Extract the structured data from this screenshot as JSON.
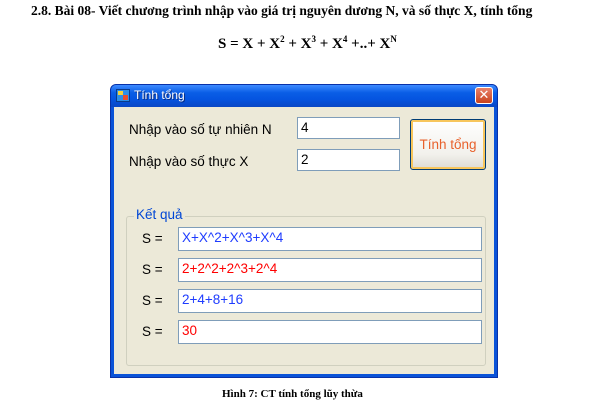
{
  "document": {
    "heading": "2.8. Bài 08- Viết chương trình nhập vào giá trị nguyên dương N, và số thực X, tính tổng",
    "formula": {
      "lhs": "S = X + X",
      "exp2": "2",
      "t3": " + X",
      "exp3": "3",
      "t4": " + X",
      "exp4": "4",
      "tail": " +..+ X",
      "expN": "N"
    },
    "caption": "Hình  7: CT tính tổng lũy thừa"
  },
  "window": {
    "title": "Tính tổng",
    "close_glyph": "✕",
    "title_color": "#0554e0"
  },
  "form": {
    "label_n": "Nhập vào số tự nhiên N",
    "value_n": "4",
    "label_x": "Nhập vào số thực X",
    "value_x": "2",
    "calc_button": "Tính tổng",
    "calc_button_color": "#e8612c"
  },
  "results": {
    "group_label": "Kết quả",
    "rows": [
      {
        "label": "S =",
        "value": "X+X^2+X^3+X^4",
        "color": "#1e3cff"
      },
      {
        "label": "S =",
        "value": "2+2^2+2^3+2^4",
        "color": "#ff0000"
      },
      {
        "label": "S =",
        "value": "2+4+8+16",
        "color": "#1e3cff"
      },
      {
        "label": "S =",
        "value": "30",
        "color": "#ff0000"
      }
    ]
  },
  "icons": {
    "app": "form-app-icon",
    "close": "close-icon"
  }
}
